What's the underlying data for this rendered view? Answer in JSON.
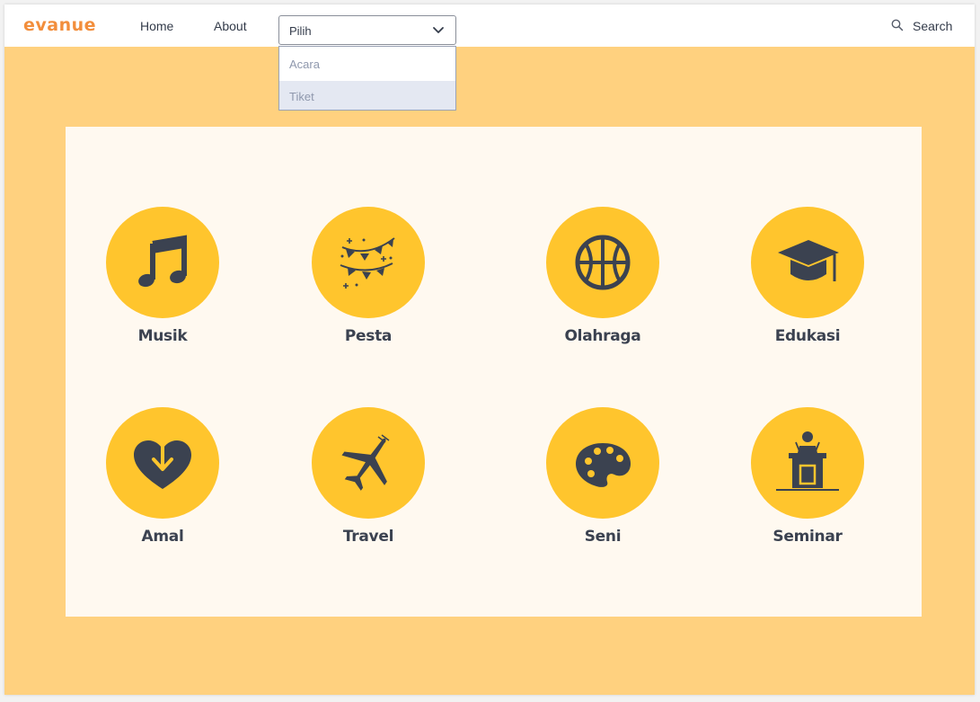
{
  "brand": {
    "name": "evanue",
    "color": "#f28e3c"
  },
  "nav": {
    "home": "Home",
    "about": "About"
  },
  "dropdown": {
    "selected": "Pilih",
    "options": [
      "Acara",
      "Tiket"
    ],
    "icon": "chevron-down-icon"
  },
  "search": {
    "label": "Search",
    "icon": "search-icon"
  },
  "colors": {
    "background": "#ffd17f",
    "panel": "#fff9f0",
    "circle": "#ffc52d",
    "icon": "#3b4250"
  },
  "categories": [
    {
      "label": "Musik",
      "icon": "music-note-icon"
    },
    {
      "label": "Pesta",
      "icon": "party-bunting-icon"
    },
    {
      "label": "Olahraga",
      "icon": "basketball-icon"
    },
    {
      "label": "Edukasi",
      "icon": "graduation-cap-icon"
    },
    {
      "label": "Amal",
      "icon": "charity-heart-icon"
    },
    {
      "label": "Travel",
      "icon": "airplane-icon"
    },
    {
      "label": "Seni",
      "icon": "art-palette-icon"
    },
    {
      "label": "Seminar",
      "icon": "podium-icon"
    }
  ]
}
